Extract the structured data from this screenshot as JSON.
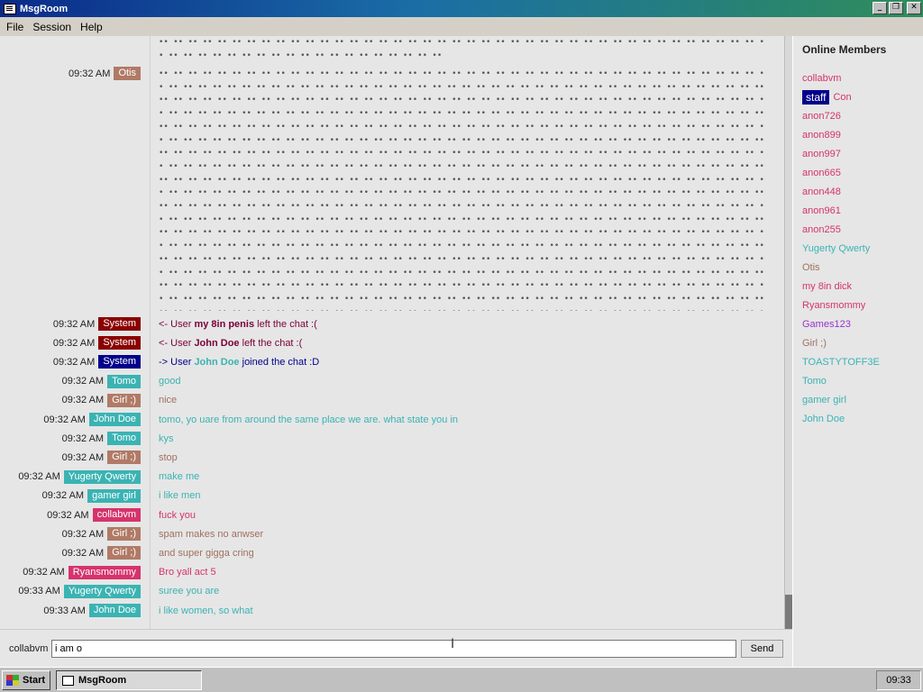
{
  "window": {
    "title": "MsgRoom"
  },
  "menu": [
    "File",
    "Session",
    "Help"
  ],
  "spam_glyphs": "•• •• •• •• •• •• •• •• •• •• •• •• •• •• •• •• •• •• •• •• •• •• •• •• •• •• •• •• •• •• •• •• •• •• •• •• •• •• •• •• •• •• •• •• •• •• •• •• •• •• ••",
  "spam_top": "•• •• •• •• •• •• •• •• •• •• •• •• •• •• •• •• •• •• •• •• •• •• •• •• •• •• •• •• •• •• •• •• •• •• •• •• •• •• •• •• •• •• •• •• •• •• •• •• •• •• •• •• •• •• •• •• •• •• •• •• ••",
  "messages": [
    {
      "time": "09:32 AM",
      "user": "System",
      "ucolor": "#8b0000",
      "pre": "<- User ",
      "name": "my 8in penis",
      "post": " left the chat :(",
      "mcolor": "#7a003a"
    },
    {
      "time": "09:32 AM",
      "user": "System",
      "ucolor": "#8b0000",
      "pre": "<- User ",
      "name": "John Doe",
      "post": " left the chat :(",
      "mcolor": "#7a003a"
    },
    {
      "time": "09:32 AM",
      "user": "System",
      "ucolor": "#00008b",
      "pre": "-> User ",
      "name": "John Doe",
      "post": " joined the chat :D",
      "mcolor": "#00008b",
      "ncolor": "#3bb3b3"
    },
    {
      "time": "09:32 AM",
      "user": "Tomo",
      "ucolor": "#3bb3b3",
      "text": "good",
      "mcolor": "#3bb3b3"
    },
    {
      "time": "09:32 AM",
      "user": "Girl ;)",
      "ucolor": "#b07a66",
      "text": "nice",
      "mcolor": "#a07060"
    },
    {
      "time": "09:32 AM",
      "user": "John Doe",
      "ucolor": "#3bb3b3",
      "text": "tomo, yo uare from around the same place we are. what state you in",
      "mcolor": "#3bb3b3"
    },
    {
      "time": "09:32 AM",
      "user": "Tomo",
      "ucolor": "#3bb3b3",
      "text": "kys",
      "mcolor": "#3bb3b3"
    },
    {
      "time": "09:32 AM",
      "user": "Girl ;)",
      "ucolor": "#b07a66",
      "text": "stop",
      "mcolor": "#a07060"
    },
    {
      "time": "09:32 AM",
      "user": "Yugerty Qwerty",
      "ucolor": "#3bb3b3",
      "text": "make me",
      "mcolor": "#3bb3b3"
    },
    {
      "time": "09:32 AM",
      "user": "gamer girl",
      "ucolor": "#3bb3b3",
      "text": "i like men",
      "mcolor": "#3bb3b3"
    },
    {
      "time": "09:32 AM",
      "user": "collabvm",
      "ucolor": "#d6336c",
      "text": "fuck you",
      "mcolor": "#d6336c"
    },
    {
      "time": "09:32 AM",
      "user": "Girl ;)",
      "ucolor": "#b07a66",
      "text": "spam makes no anwser",
      "mcolor": "#a07060"
    },
    {
      "time": "09:32 AM",
      "user": "Girl ;)",
      "ucolor": "#b07a66",
      "text": "and super gigga cring",
      "mcolor": "#a07060"
    },
    {
      "time": "09:32 AM",
      "user": "Ryansmommy",
      "ucolor": "#d6336c",
      "text": "Bro yall act 5",
      "mcolor": "#d6336c"
    },
    {
      "time": "09:33 AM",
      "user": "Yugerty Qwerty",
      "ucolor": "#3bb3b3",
      "text": "suree you are",
      "mcolor": "#3bb3b3"
    },
    {
      "time": "09:33 AM",
      "user": "John Doe",
      "ucolor": "#3bb3b3",
      "text": "i like women, so what",
      "mcolor": "#3bb3b3"
    }
  ],
  "otis_row": {
    "time": "09:32 AM",
    "user": "Otis",
    "ucolor": "#b07a66"
  },
  "members_header": "Online Members",
  "members": [
    {
      "name": "collabvm",
      "color": "#d6336c"
    },
    {
      "name": "Con",
      "color": "#d6336c",
      "badge": "staff"
    },
    {
      "name": "anon726",
      "color": "#d6336c"
    },
    {
      "name": "anon899",
      "color": "#d6336c"
    },
    {
      "name": "anon997",
      "color": "#d6336c"
    },
    {
      "name": "anon665",
      "color": "#d6336c"
    },
    {
      "name": "anon448",
      "color": "#d6336c"
    },
    {
      "name": "anon961",
      "color": "#d6336c"
    },
    {
      "name": "anon255",
      "color": "#d6336c"
    },
    {
      "name": "Yugerty Qwerty",
      "color": "#3bb3b3"
    },
    {
      "name": "Otis",
      "color": "#a07060"
    },
    {
      "name": "my 8in dick",
      "color": "#d6336c"
    },
    {
      "name": "Ryansmommy",
      "color": "#d6336c"
    },
    {
      "name": "Games123",
      "color": "#9933cc"
    },
    {
      "name": "Girl ;)",
      "color": "#a07060"
    },
    {
      "name": "TOASTYTOFF3E",
      "color": "#3bb3b3"
    },
    {
      "name": "Tomo",
      "color": "#3bb3b3"
    },
    {
      "name": "gamer girl",
      "color": "#3bb3b3"
    },
    {
      "name": "John Doe",
      "color": "#3bb3b3"
    }
  ],
  "input": {
    "nick": "collabvm",
    "value": "i am o",
    "send_label": "Send"
  },
  "taskbar": {
    "start_label": "Start",
    "task_label": "MsgRoom",
    "clock": "09:33"
  }
}
